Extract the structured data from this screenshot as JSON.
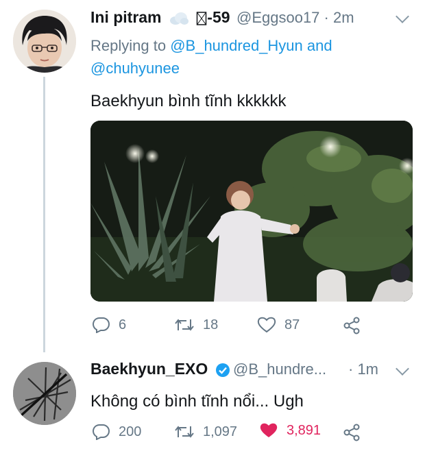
{
  "tweet1": {
    "name": "Ini pitram",
    "name_suffix": "-59",
    "handle": "@Eggsoo17",
    "time": "· 2m",
    "reply_prefix": "Replying to",
    "reply_user1": "@B_hundred_Hyun",
    "reply_and": "and",
    "reply_user2": "@chuhyunee",
    "text": "Baekhyun bình tĩnh kkkkkk",
    "replies": "6",
    "retweets": "18",
    "likes": "87"
  },
  "tweet2": {
    "name": "Baekhyun_EXO",
    "handle": "@B_hundre...",
    "time": "· 1m",
    "text": "Không có bình tĩnh nổi... Ugh",
    "replies": "200",
    "retweets": "1,097",
    "likes": "3,891",
    "liked": true
  },
  "colors": {
    "text": "#14171a",
    "muted": "#657786",
    "link": "#1b95e0",
    "like": "#e0245e",
    "verified": "#1da1f2"
  },
  "icons": [
    "cloud-emoji-icon",
    "missing-glyph-icon",
    "chevron-down-icon",
    "reply-icon",
    "retweet-icon",
    "like-icon",
    "share-icon",
    "verified-badge-icon"
  ]
}
